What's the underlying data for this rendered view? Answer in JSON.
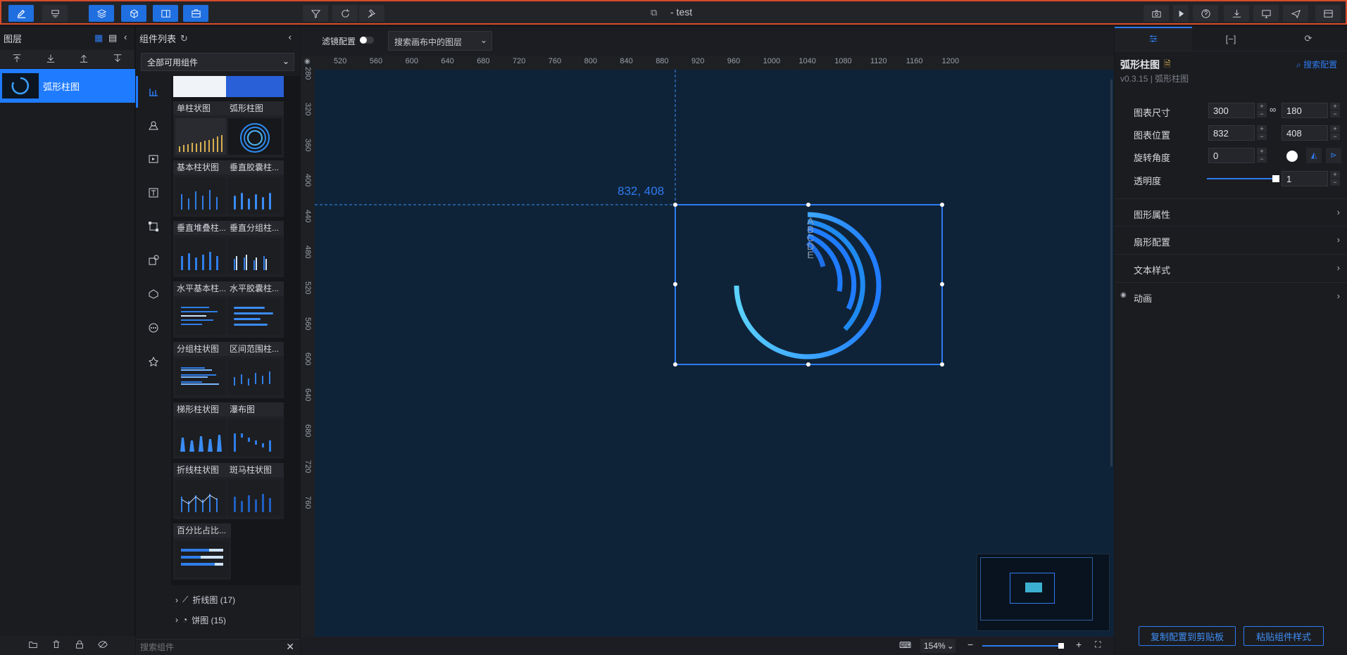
{
  "topbar": {
    "title": "- test"
  },
  "layers": {
    "header": "图层",
    "items": [
      {
        "label": "弧形柱图"
      }
    ]
  },
  "complist": {
    "header": "组件列表",
    "filter_value": "全部可用组件",
    "cards": [
      {
        "label": "单柱状图"
      },
      {
        "label": "弧形柱图"
      },
      {
        "label": "基本柱状图"
      },
      {
        "label": "垂直胶囊柱..."
      },
      {
        "label": "垂直堆叠柱..."
      },
      {
        "label": "垂直分组柱..."
      },
      {
        "label": "水平基本柱..."
      },
      {
        "label": "水平胶囊柱..."
      },
      {
        "label": "分组柱状图"
      },
      {
        "label": "区间范围柱..."
      },
      {
        "label": "梯形柱状图"
      },
      {
        "label": "瀑布图"
      },
      {
        "label": "折线柱状图"
      },
      {
        "label": "斑马柱状图"
      },
      {
        "label": "百分比占比..."
      }
    ],
    "groups": [
      {
        "label": "折线图 (17)"
      },
      {
        "label": "饼图 (15)"
      }
    ],
    "search_placeholder": "搜索组件"
  },
  "canvas": {
    "filter_label": "滤镜配置",
    "search_placeholder": "搜索画布中的图层",
    "coord_label": "832, 408",
    "ruler_x": [
      "520",
      "560",
      "600",
      "640",
      "680",
      "720",
      "760",
      "800",
      "840",
      "880",
      "920",
      "960",
      "1000",
      "1040",
      "1080",
      "1120",
      "1160",
      "1200"
    ],
    "ruler_y": [
      "280",
      "320",
      "360",
      "400",
      "440",
      "480",
      "520",
      "560",
      "600",
      "640",
      "680",
      "720",
      "760"
    ],
    "legend_letters": [
      "A",
      "B",
      "C",
      "D",
      "E"
    ],
    "zoom": "154%"
  },
  "props": {
    "title": "弧形柱图",
    "search_config": "搜索配置",
    "version": "v0.3.15 | 弧形柱图",
    "size_label": "图表尺寸",
    "width": "300",
    "height": "180",
    "pos_label": "图表位置",
    "x": "832",
    "y": "408",
    "rotate_label": "旋转角度",
    "rotate": "0",
    "opacity_label": "透明度",
    "opacity": "1",
    "opacity_fraction": 0.98,
    "sections": [
      {
        "label": "图形属性"
      },
      {
        "label": "扇形配置"
      },
      {
        "label": "文本样式"
      },
      {
        "label": "动画"
      }
    ],
    "copy_btn": "复制配置到剪贴板",
    "paste_btn": "粘贴组件样式"
  }
}
